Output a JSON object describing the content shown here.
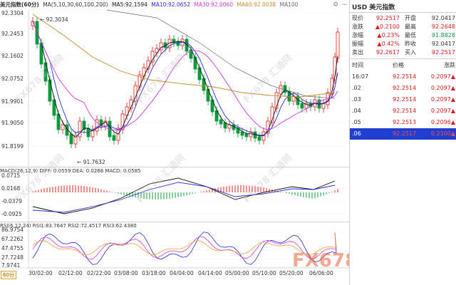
{
  "header": {
    "symbol": "美元指数(60分)",
    "ma_params": "MA(5,10,30,60,100,200)",
    "ma5": "MA5:92.1594",
    "ma10": "MA10:92.0652",
    "ma30": "MA30:92.0060",
    "ma60": "MA60:92.0038",
    "ma100": "MA100"
  },
  "colors": {
    "up": "#e01b1b",
    "down": "#0a9a3c",
    "ma5": "#111111",
    "ma10": "#2a2ad8",
    "ma30": "#d13be0",
    "ma60": "#c98a2a",
    "ma100": "#6b6b6b"
  },
  "price_axis": [
    "92.3304",
    "92.2453",
    "92.1602",
    "92.0752",
    "91.9901",
    "91.9050",
    "91.8199"
  ],
  "price_markers": {
    "high": "92.3034",
    "low": "91.7632"
  },
  "macd": {
    "label": "MACD(26,12,9) DIFF: 0.0559 DEA: 0.0266 MACD: 0.0585",
    "axis": [
      "0.0715",
      "0.0168",
      "-0.0379",
      "-0.0925"
    ]
  },
  "rsi": {
    "label": "RSI(6,12,24) RSI1:83.7647 RSI2:72.4517 RSI3:62.4380",
    "axis": [
      "86.9754",
      "67.2262",
      "47.4755",
      "27.7248",
      "7.9741"
    ]
  },
  "dates": [
    "30/02:00",
    "02/12:00",
    "02/22:00",
    "03/08:00",
    "03/18:00",
    "04/04:00",
    "04/14:00",
    "05/00:00",
    "05/10:00",
    "05/20:00",
    "06/06:00"
  ],
  "period_button": "60分",
  "watermark": "FX678 汇通网",
  "logo": "FX678汇通网",
  "panel": {
    "title": "USD 美元指数",
    "quote": [
      {
        "k1": "现价",
        "v1": "92.2517",
        "c1": "red",
        "k2": "开盘",
        "v2": "92.0417",
        "c2": "dark"
      },
      {
        "k1": "涨跌",
        "v1": "▲0.2100",
        "c1": "red",
        "k2": "最高",
        "v2": "92.2648",
        "c2": "red"
      },
      {
        "k1": "涨幅",
        "v1": "▲0.23%",
        "c1": "red",
        "k2": "最低",
        "v2": "91.8828",
        "c2": "green"
      },
      {
        "k1": "振幅",
        "v1": "▲0.42%",
        "c1": "red",
        "k2": "昨收",
        "v2": "92.0417",
        "c2": "dark"
      },
      {
        "k1": "卖出",
        "v1": "92.2617",
        "c1": "red",
        "k2": "买入",
        "v2": "92.2517",
        "c2": "red"
      }
    ],
    "ticks_header": {
      "time": "时间",
      "price": "价格",
      "change": "涨跌"
    },
    "ticks": [
      {
        "time": "16:07",
        "price": "92.2514",
        "change": "0.2097▲"
      },
      {
        "time": ".02",
        "price": "92.2514",
        "change": "0.2097▲"
      },
      {
        "time": ".03",
        "price": "92.2514",
        "change": "0.2097▲"
      },
      {
        "time": ".04",
        "price": "92.2514",
        "change": "0.2097▲"
      },
      {
        "time": ".05",
        "price": "92.2513",
        "change": "0.2096▲"
      },
      {
        "time": ".06",
        "price": "92.2517",
        "change": "0.2100▲"
      }
    ]
  },
  "top_right_buttons": [
    "gear",
    "minus"
  ]
}
